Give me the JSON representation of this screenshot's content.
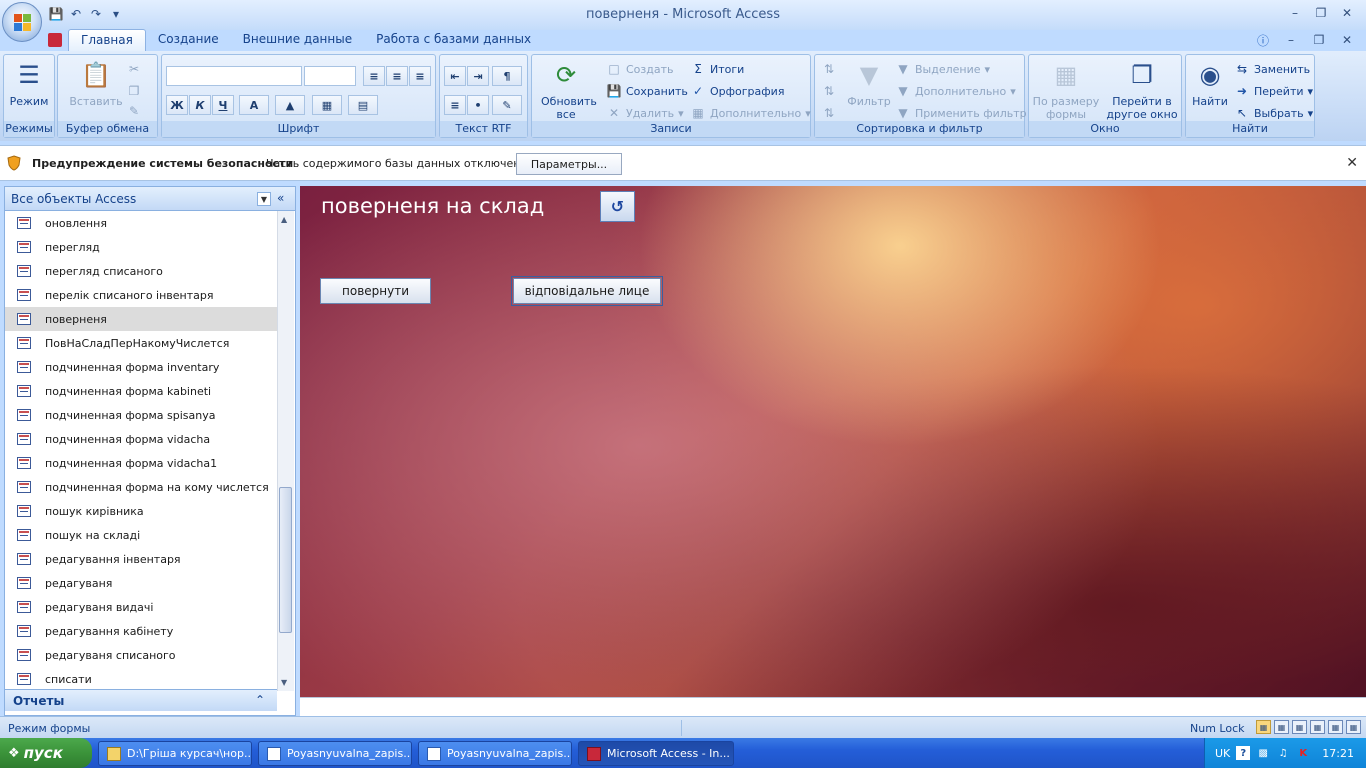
{
  "window": {
    "title": "поверненя - Microsoft Access"
  },
  "tabs": [
    "Главная",
    "Создание",
    "Внешние данные",
    "Работа с базами данных"
  ],
  "ribbon": {
    "groups": {
      "views": "Режимы",
      "clipboard": "Буфер обмена",
      "font": "Шрифт",
      "rtf": "Текст RTF",
      "records": "Записи",
      "sort": "Сортировка и фильтр",
      "window": "Окно",
      "find": "Найти"
    },
    "view_btn": "Режим",
    "paste_btn": "Вставить",
    "refresh_btn": "Обновить все",
    "records_new": "Создать",
    "records_save": "Сохранить",
    "records_delete": "Удалить",
    "records_totals": "Итоги",
    "records_spelling": "Орфография",
    "records_more": "Дополнительно",
    "filter_btn": "Фильтр",
    "sel_btn": "Выделение",
    "adv_btn": "Дополнительно",
    "toggle_btn": "Применить фильтр",
    "fit_btn_1": "По размеру",
    "fit_btn_2": "формы",
    "switch_btn_1": "Перейти в",
    "switch_btn_2": "другое окно",
    "find_btn": "Найти",
    "replace_btn": "Заменить",
    "goto_btn": "Перейти",
    "select_btn": "Выбрать",
    "bold": "Ж",
    "italic": "К",
    "underline": "Ч"
  },
  "security": {
    "title": "Предупреждение системы безопасности",
    "message": "Часть содержимого базы данных отключено",
    "button": "Параметры..."
  },
  "nav": {
    "title": "Все объекты Access",
    "items": [
      "оновлення",
      "перегляд",
      "перегляд списаного",
      "перелік списаного інвентаря",
      "поверненя",
      "ПовНаСладПерНакомуЧислется",
      "подчиненная форма inventary",
      "подчиненная форма kabineti",
      "подчиненная форма spisanya",
      "подчиненная форма vidacha",
      "подчиненная форма vidacha1",
      "подчиненная форма на кому числется",
      "пошук кирівника",
      "пошук на складі",
      "редагування інвентаря",
      "редагуваня",
      "редагуваня видачі",
      "редагування кабінету",
      "редагуваня списаного",
      "списати"
    ],
    "selected_index": 4,
    "reports": "Отчеты"
  },
  "form": {
    "title": "поверненя на склад",
    "btn_return": "повернути",
    "btn_responsible": "відповідальне лице"
  },
  "status": {
    "mode": "Режим формы",
    "numlock": "Num Lock"
  },
  "taskbar": {
    "start": "пуск",
    "tasks": [
      "D:\\Гріша курсач\\нор...",
      "Poyasnyuvalna_zapis...",
      "Poyasnyuvalna_zapis...",
      "Microsoft Access - In..."
    ],
    "lang": "UK",
    "time": "17:21"
  }
}
